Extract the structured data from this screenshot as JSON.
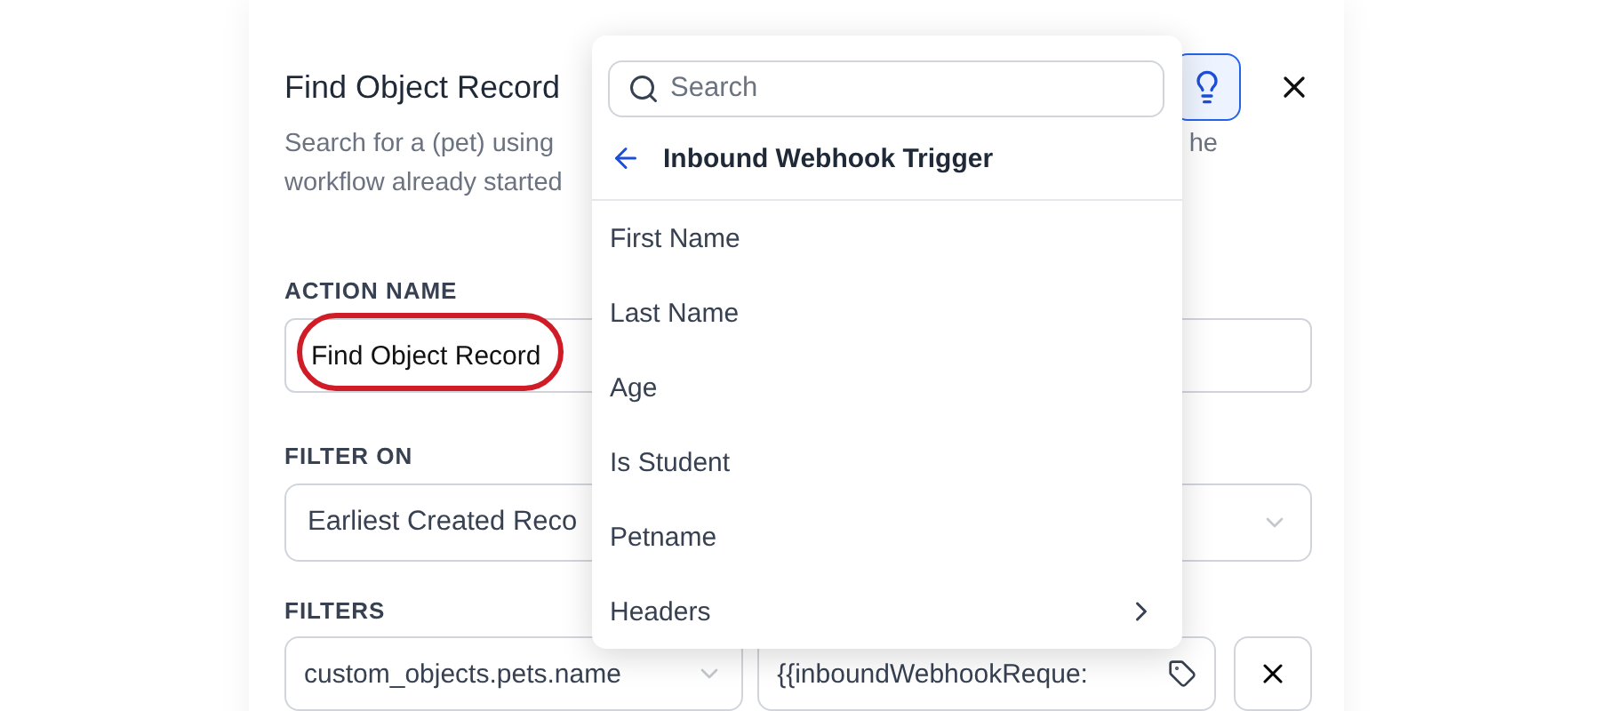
{
  "panel": {
    "title": "Find Object Record",
    "description_lines": [
      {
        "left": "Search for a (pet) using",
        "right": "he"
      },
      {
        "left": "workflow already started"
      }
    ],
    "action_name": {
      "label": "ACTION NAME",
      "value": "Find Object Record",
      "highlighted": true
    },
    "filter_on": {
      "label": "FILTER ON",
      "value": "Earliest Created Reco"
    },
    "filters": {
      "label": "FILTERS",
      "field": "custom_objects.pets.name",
      "value": "{{inboundWebhookReque:"
    }
  },
  "popup": {
    "search": {
      "placeholder": "Search"
    },
    "back_title": "Inbound Webhook Trigger",
    "items": [
      {
        "label": "First Name",
        "has_children": false
      },
      {
        "label": "Last Name",
        "has_children": false
      },
      {
        "label": "Age",
        "has_children": false
      },
      {
        "label": "Is Student",
        "has_children": false
      },
      {
        "label": "Petname",
        "has_children": false
      },
      {
        "label": "Headers",
        "has_children": true
      }
    ]
  }
}
